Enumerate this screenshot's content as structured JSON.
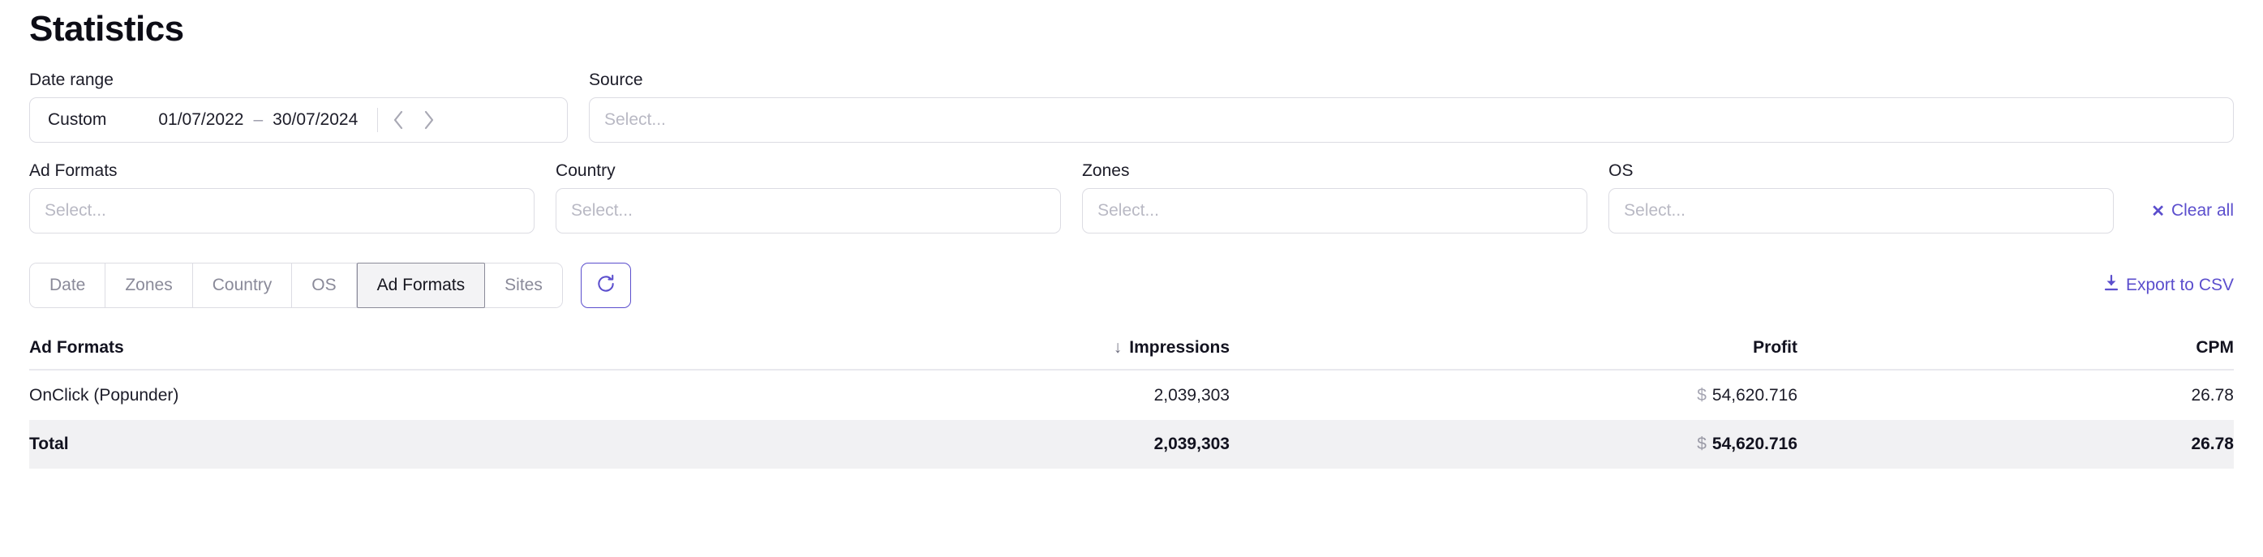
{
  "page": {
    "title": "Statistics"
  },
  "filters": {
    "date_range": {
      "label": "Date range",
      "preset": "Custom",
      "start": "01/07/2022",
      "dash": "–",
      "end": "30/07/2024",
      "prev_icon": "chevron-left-icon",
      "next_icon": "chevron-right-icon"
    },
    "source": {
      "label": "Source",
      "placeholder": "Select...",
      "value": ""
    },
    "ad_formats": {
      "label": "Ad Formats",
      "placeholder": "Select...",
      "value": ""
    },
    "country": {
      "label": "Country",
      "placeholder": "Select...",
      "value": ""
    },
    "zones": {
      "label": "Zones",
      "placeholder": "Select...",
      "value": ""
    },
    "os": {
      "label": "OS",
      "placeholder": "Select...",
      "value": ""
    },
    "clear_all": {
      "label": "Clear all",
      "icon": "close-x-icon"
    }
  },
  "toolbar": {
    "tabs": [
      {
        "label": "Date",
        "active": false
      },
      {
        "label": "Zones",
        "active": false
      },
      {
        "label": "Country",
        "active": false
      },
      {
        "label": "OS",
        "active": false
      },
      {
        "label": "Ad Formats",
        "active": true
      },
      {
        "label": "Sites",
        "active": false
      }
    ],
    "refresh": {
      "icon": "refresh-icon",
      "label": ""
    },
    "export": {
      "label": "Export to CSV",
      "icon": "download-icon"
    }
  },
  "table": {
    "columns": [
      {
        "key": "name",
        "label": "Ad Formats",
        "align": "left",
        "sorted": false
      },
      {
        "key": "impressions",
        "label": "Impressions",
        "align": "right",
        "sorted": true,
        "sort_dir": "desc",
        "sort_glyph": "↓"
      },
      {
        "key": "profit",
        "label": "Profit",
        "align": "right",
        "sorted": false
      },
      {
        "key": "cpm",
        "label": "CPM",
        "align": "right",
        "sorted": false
      }
    ],
    "rows": [
      {
        "name": "OnClick (Popunder)",
        "impressions": "2,039,303",
        "profit_symbol": "$",
        "profit": "54,620.716",
        "cpm": "26.78"
      }
    ],
    "total": {
      "name": "Total",
      "impressions": "2,039,303",
      "profit_symbol": "$",
      "profit": "54,620.716",
      "cpm": "26.78"
    }
  },
  "colors": {
    "accent": "#5b4ecd",
    "text": "#12121f",
    "muted": "#8a8a99",
    "border": "#dcdce3",
    "total_row_bg": "#f1f1f3",
    "active_tab_bg": "#f3f3f5"
  }
}
